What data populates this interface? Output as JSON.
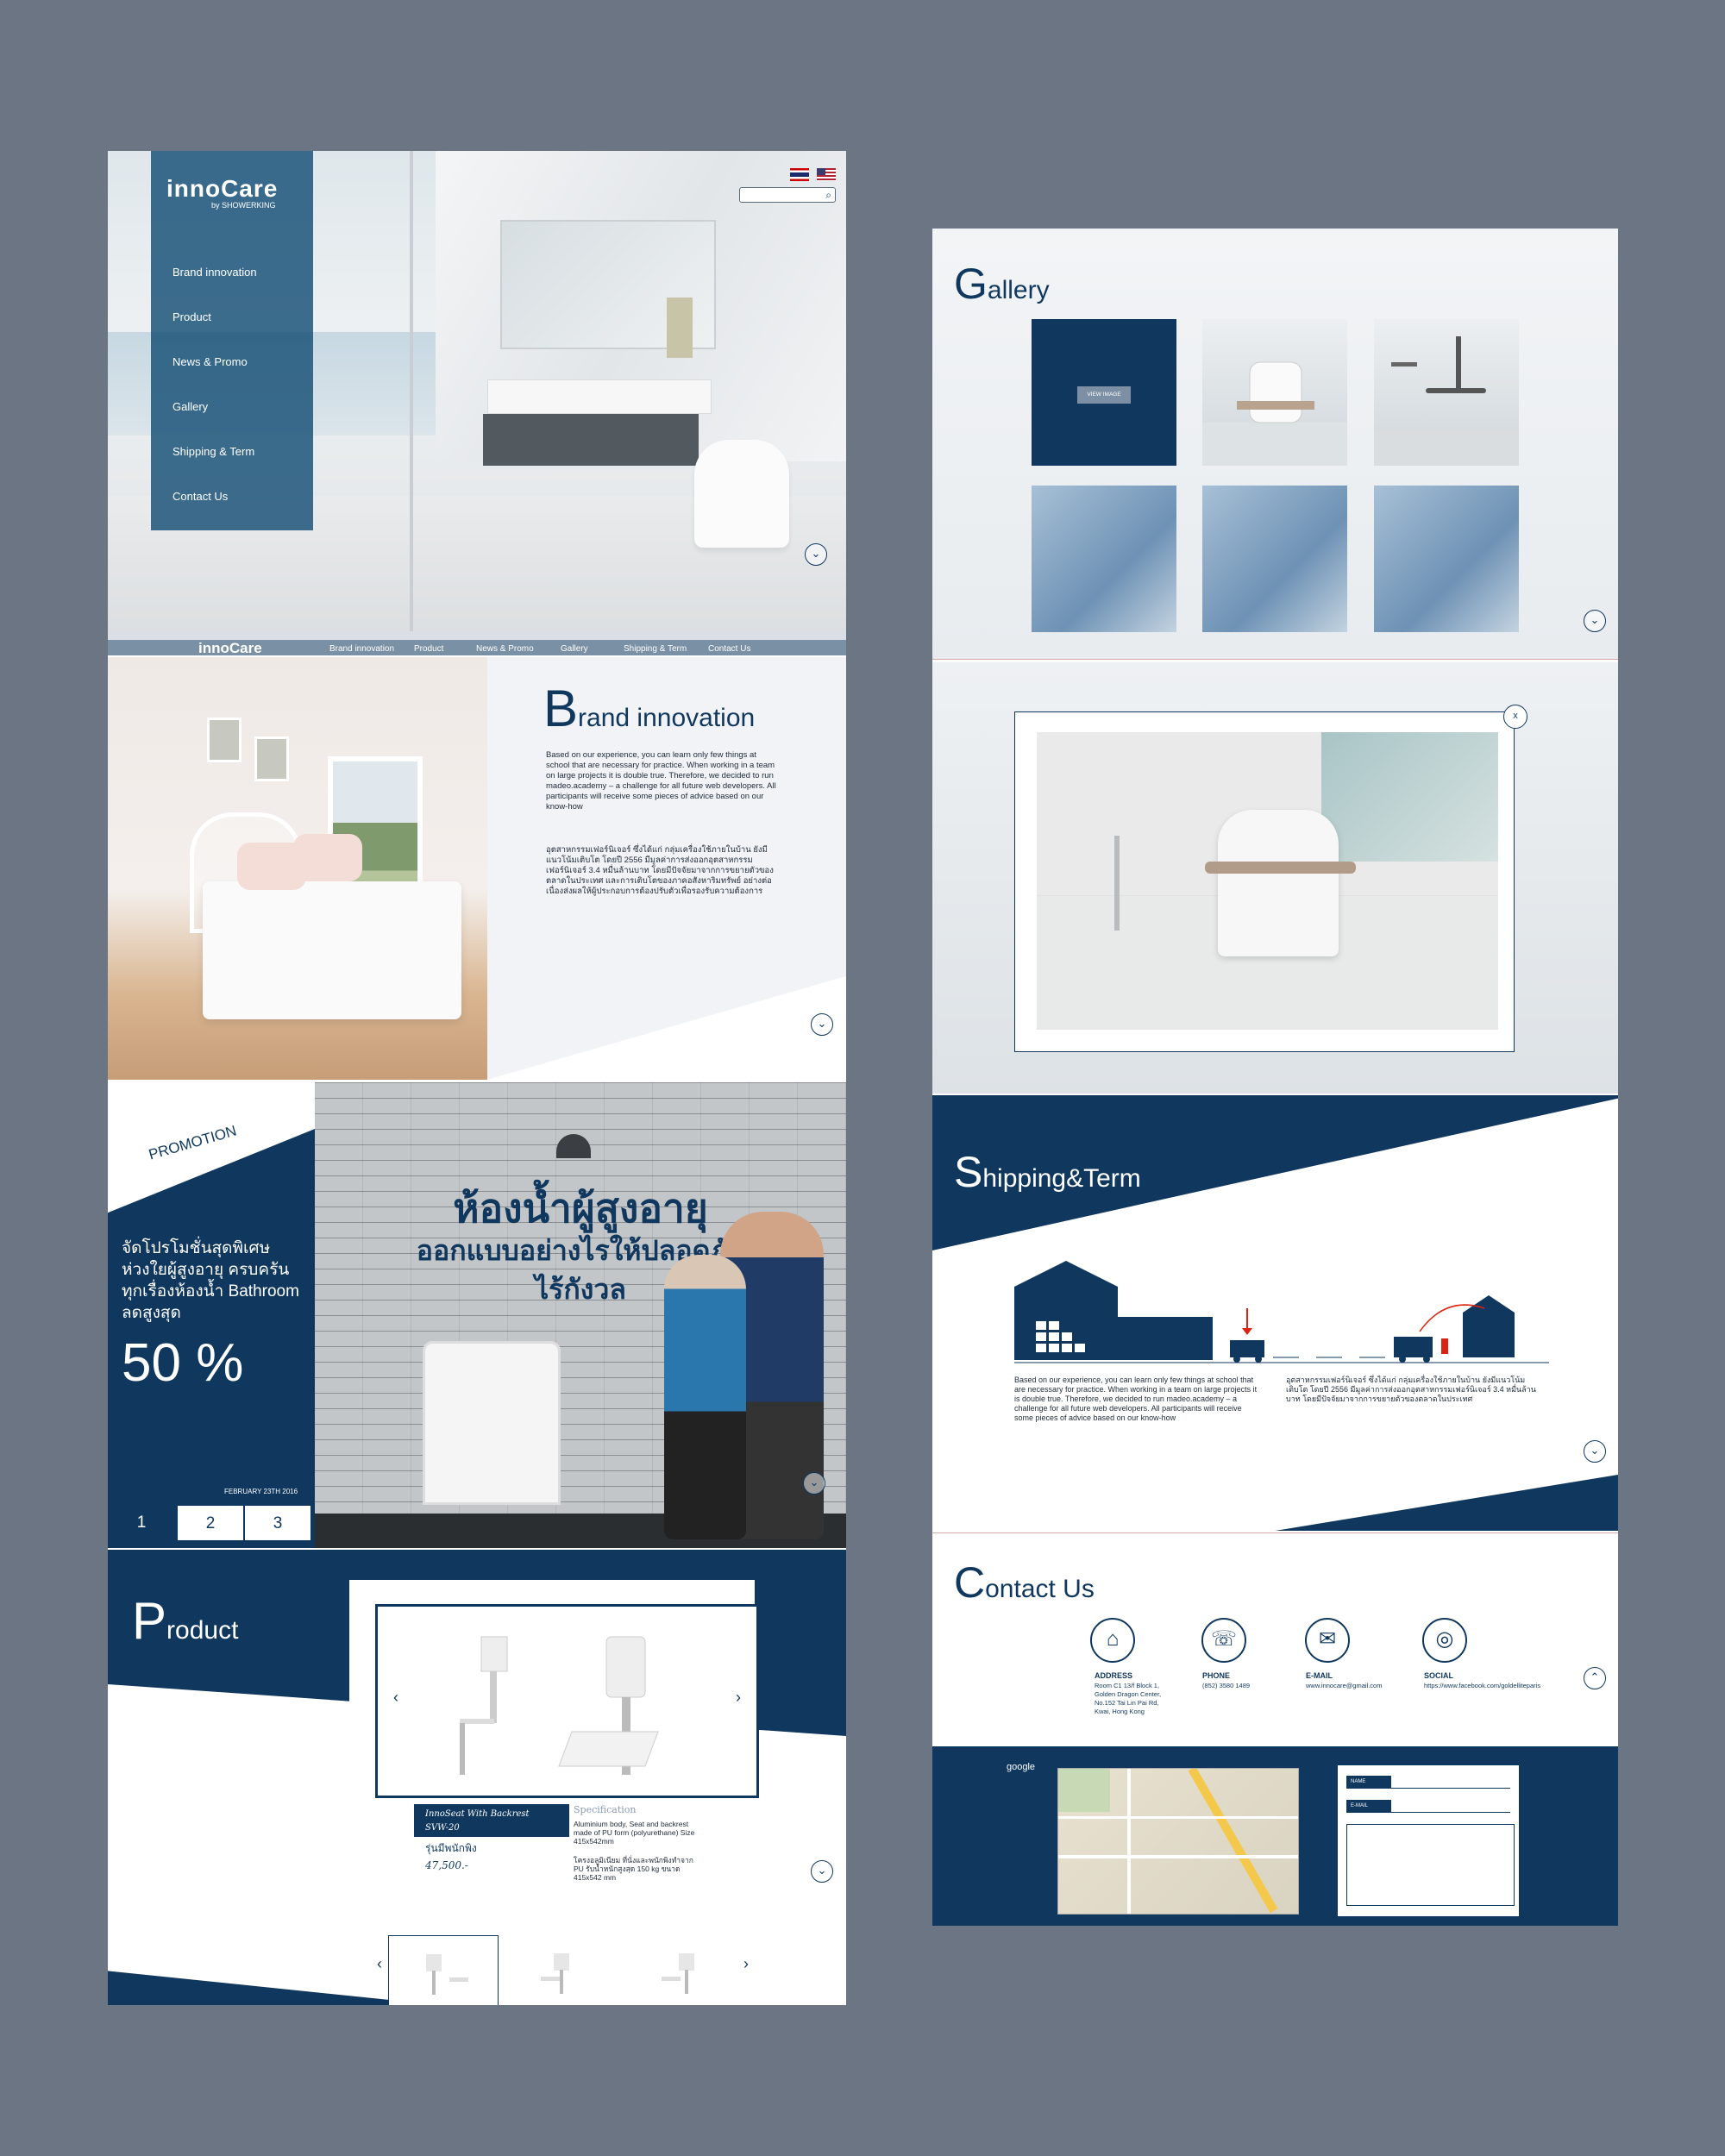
{
  "brand": {
    "logo": "innoCare",
    "logo_sub": "by SHOWERKING"
  },
  "hero": {
    "menu": [
      "Brand innovation",
      "Product",
      "News & Promo",
      "Gallery",
      "Shipping & Term",
      "Contact Us"
    ],
    "scroll_icon": "chevron-down-icon"
  },
  "navbar": {
    "logo": "innoCare",
    "items": [
      "Brand innovation",
      "Product",
      "News & Promo",
      "Gallery",
      "Shipping & Term",
      "Contact Us"
    ]
  },
  "brand_innovation": {
    "title_initial": "B",
    "title_rest": "rand innovation",
    "para_en": "Based on our experience, you can learn only few things at school that are necessary for practice. When working in a team on large projects it is double true. Therefore, we decided to run madeo.academy – a challenge for all future web developers. All participants will receive some pieces of advice based on our know-how",
    "para_th": "อุตสาหกรรมเฟอร์นิเจอร์ ซึ่งได้แก่ กลุ่มเครื่องใช้ภายในบ้าน ยังมีแนวโน้มเติบโต โดยปี 2556 มีมูลค่าการส่งออกอุตสาหกรรมเฟอร์นิเจอร์ 3.4 หมื่นล้านบาท โดยมีปัจจัยมาจากการขยายตัวของตลาดในประเทศ และการเติบโตของภาคอสังหาริมทรัพย์ อย่างต่อเนื่องส่งผลให้ผู้ประกอบการต้องปรับตัวเพื่อรองรับความต้องการ"
  },
  "promotion": {
    "label": "PROMOTION",
    "text": "จัดโปรโมชั่นสุดพิเศษ ห่วงใยผู้สูงอายุ ครบครันทุกเรื่องห้องน้ำ Bathroom ลดสูงสุด",
    "percent": "50 %",
    "date": "FEBRUARY 23TH 2016",
    "pages": [
      "1",
      "2",
      "3"
    ],
    "headline1": "ห้องน้ำผู้สูงอายุ",
    "headline2": "ออกแบบอย่างไรให้ปลอดภัย",
    "headline3": "ไร้กังวล"
  },
  "product": {
    "title_initial": "P",
    "title_rest": "roduct",
    "name": "InnoSeat With Backrest",
    "code": "SVW-20",
    "name_th": "รุ่นมีพนักพิง",
    "price": "47,500.-",
    "spec_title": "Specification",
    "spec_en": "Aluminium body, Seat and backrest made of PU form (polyurethane) Size 415x542mm",
    "spec_th": "โครงอลูมิเนียม ที่นั่งและพนักพิงทำจาก PU รับน้ำหนักสูงสุด 150 kg ขนาด 415x542 mm"
  },
  "gallery": {
    "title_initial": "G",
    "title_rest": "allery",
    "view_label": "VIEW IMAGE"
  },
  "modal": {
    "close": "x"
  },
  "shipping": {
    "title_initial": "S",
    "title_rest": "hipping&Term",
    "para_en": "Based on our experience, you can learn only few things at school that are necessary for practice. When working in a team on large projects it is double true. Therefore, we decided to run madeo.academy – a challenge for all future web developers. All participants will receive some pieces of advice based on our know-how",
    "para_th": "อุตสาหกรรมเฟอร์นิเจอร์ ซึ่งได้แก่ กลุ่มเครื่องใช้ภายในบ้าน ยังมีแนวโน้มเติบโต โดยปี 2556 มีมูลค่าการส่งออกอุตสาหกรรมเฟอร์นิเจอร์ 3.4 หมื่นล้านบาท โดยมีปัจจัยมาจากการขยายตัวของตลาดในประเทศ"
  },
  "contact": {
    "title_initial": "C",
    "title_rest": "ontact Us",
    "address_label": "ADDRESS",
    "address": "Room C1 13/f Block 1, Golden Dragon Center, No.152 Tai Lin Pai Rd, Kwai, Hong Kong",
    "phone_label": "PHONE",
    "phone": "(852) 3580 1489",
    "email_label": "E-MAIL",
    "email": "www.innocare@gmail.com",
    "social_label": "SOCIAL",
    "social": "https://www.facebook.com/goldelliteparis"
  },
  "footer": {
    "map_label": "google",
    "form_name": "NAME",
    "form_email": "E-MAIL"
  },
  "colors": {
    "navy": "#10375e",
    "background": "#6b7583"
  }
}
